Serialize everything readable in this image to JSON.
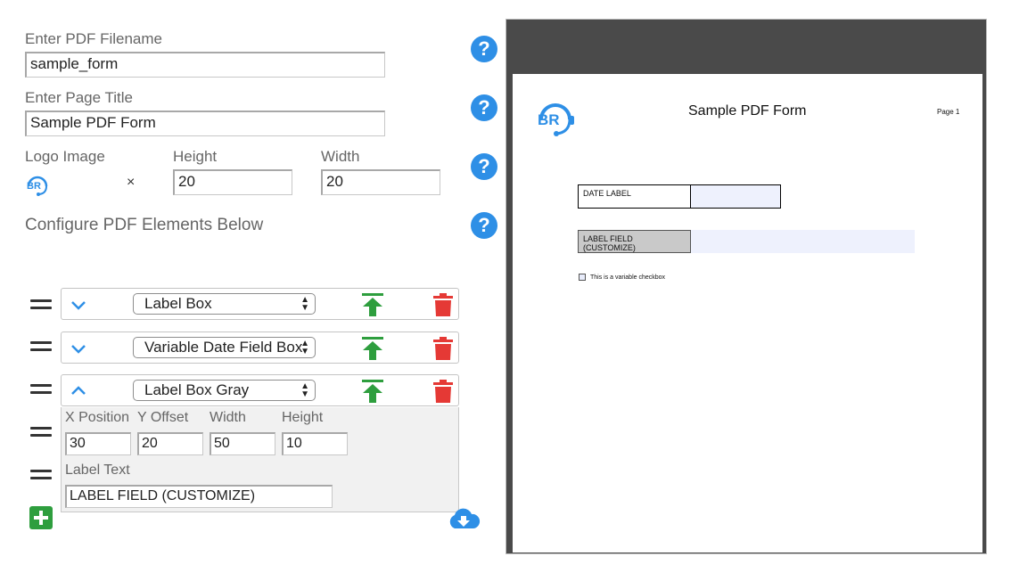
{
  "form": {
    "filename_label": "Enter PDF Filename",
    "filename_value": "sample_form",
    "page_title_label": "Enter Page Title",
    "page_title_value": "Sample PDF Form",
    "logo_label": "Logo Image",
    "logo_text": "BR",
    "times": "×",
    "height_label": "Height",
    "height_value": "20",
    "width_label": "Width",
    "width_value": "20",
    "configure_label": "Configure PDF Elements Below",
    "help_glyph": "?"
  },
  "elements": [
    {
      "type": "Label Box",
      "expanded": false
    },
    {
      "type": "Variable Date Field Box",
      "expanded": false
    },
    {
      "type": "Label Box Gray",
      "expanded": true
    }
  ],
  "detail": {
    "x_label": "X Position",
    "x_value": "30",
    "y_label": "Y Offset",
    "y_value": "20",
    "w_label": "Width",
    "w_value": "50",
    "h_label": "Height",
    "h_value": "10",
    "text_label": "Label Text",
    "text_value": "LABEL FIELD (CUSTOMIZE)"
  },
  "preview": {
    "logo_text": "BR",
    "title": "Sample PDF Form",
    "page_label": "Page 1",
    "date_label": "DATE LABEL",
    "gray_label": "LABEL FIELD (CUSTOMIZE)",
    "checkbox_label": "This is a variable checkbox"
  },
  "colors": {
    "accent_blue": "#2e8fe6",
    "green": "#2e9e3e",
    "red": "#e53935",
    "preview_bg": "#4a4a4a",
    "field_fill": "#eef1fd",
    "gray_label_fill": "#c9c9c9"
  },
  "icons": [
    "help-icon",
    "drag-handle-icon",
    "chevron-down-icon",
    "chevron-up-icon",
    "move-top-icon",
    "trash-icon",
    "add-icon",
    "cloud-download-icon"
  ]
}
